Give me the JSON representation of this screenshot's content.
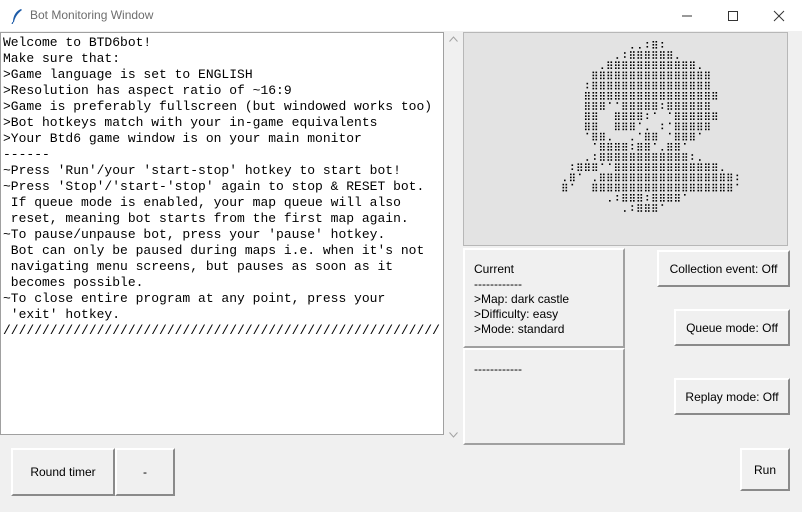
{
  "window": {
    "title": "Bot Monitoring Window",
    "icon": "feather-icon",
    "controls": [
      "minimize-icon",
      "maximize-icon",
      "close-icon"
    ]
  },
  "log": {
    "lines": [
      "Welcome to BTD6bot!",
      "Make sure that:",
      ">Game language is set to ENGLISH",
      ">Resolution has aspect ratio of ~16:9",
      ">Game is preferably fullscreen (but windowed works too)",
      ">Bot hotkeys match with your in-game equivalents",
      ">Your Btd6 game window is on your main monitor",
      "------",
      "~Press 'Run'/your 'start-stop' hotkey to start bot!",
      "~Press 'Stop'/'start-'stop' again to stop & RESET bot.",
      " If queue mode is enabled, your map queue will also",
      " reset, meaning bot starts from the first map again.",
      "~To pause/unpause bot, press your 'pause' hotkey.",
      " Bot can only be paused during maps i.e. when it's not",
      " navigating menu screens, but pauses as soon as it",
      " becomes possible.",
      "~To close entire program at any point, press your",
      " 'exit' hotkey.",
      "////////////////////////////////////////////////////////"
    ]
  },
  "current": {
    "lines": [
      "Current",
      "------------",
      ">Map: dark castle",
      ">Difficulty: easy",
      ">Mode: standard"
    ]
  },
  "status_panel": {
    "lines": [
      "------------"
    ]
  },
  "buttons": {
    "collection": "Collection event: Off",
    "queue": "Queue mode: Off",
    "replay": "Replay mode: Off",
    "run": "Run"
  },
  "round_timer": {
    "label": "Round timer",
    "value": "-"
  },
  "logo": {
    "icon": "monkey-ascii-art-logo",
    "color": "#000000"
  }
}
